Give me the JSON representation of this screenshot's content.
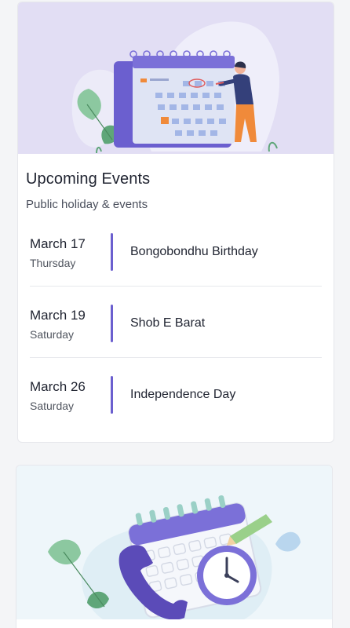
{
  "upcoming": {
    "title": "Upcoming Events",
    "subtitle": "Public holiday & events",
    "events": [
      {
        "date": "March 17",
        "day": "Thursday",
        "name": "Bongobondhu Birthday"
      },
      {
        "date": "March 19",
        "day": "Saturday",
        "name": "Shob E Barat"
      },
      {
        "date": "March 26",
        "day": "Saturday",
        "name": "Independence Day"
      }
    ]
  },
  "colors": {
    "accent": "#6b5fcf",
    "hero_bg": "#e2def4",
    "second_hero_bg": "#eef6fa"
  },
  "icons": [
    "calendar-illustration",
    "person-illustration",
    "clock-icon",
    "phone-icon",
    "pencil-icon",
    "leaf-icon"
  ]
}
